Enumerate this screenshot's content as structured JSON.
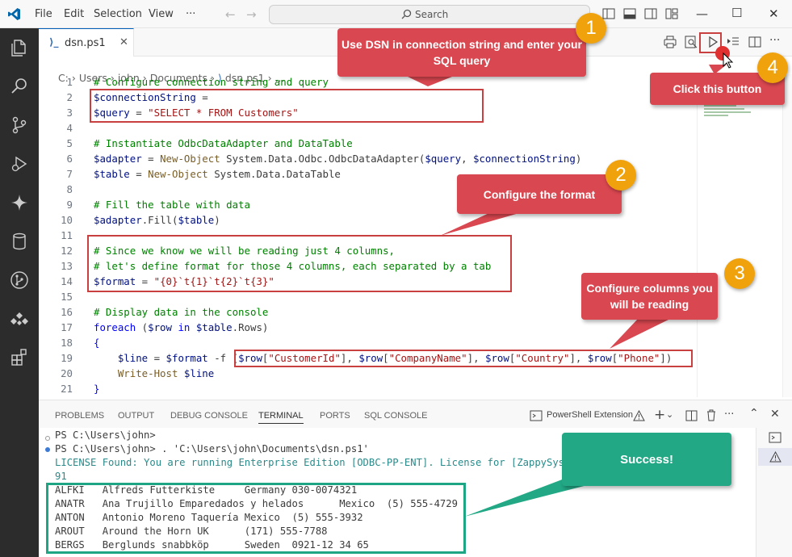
{
  "menu": {
    "file": "File",
    "edit": "Edit",
    "selection": "Selection",
    "view": "View",
    "more": "···"
  },
  "search": {
    "label": "Search"
  },
  "tab": {
    "icon": "⟩_",
    "name": "dsn.ps1",
    "close": "✕"
  },
  "breadcrumb": [
    "C:",
    "Users",
    "john",
    "Documents",
    "dsn.ps1",
    "..."
  ],
  "code_lines": [
    {
      "n": "1",
      "html": "<span class='cm'># Configure connection string and query</span>"
    },
    {
      "n": "2",
      "html": "<span class='vr'>$connectionString</span> ="
    },
    {
      "n": "3",
      "html": "<span class='vr'>$query</span> = <span class='st'>\"SELECT * FROM Customers\"</span>"
    },
    {
      "n": "4",
      "html": ""
    },
    {
      "n": "5",
      "html": "<span class='cm'># Instantiate OdbcDataAdapter and DataTable</span>"
    },
    {
      "n": "6",
      "html": "<span class='vr'>$adapter</span> = <span class='fn'>New-Object</span> System.Data.Odbc.OdbcDataAdapter(<span class='vr'>$query</span>, <span class='vr'>$connectionString</span>)"
    },
    {
      "n": "7",
      "html": "<span class='vr'>$table</span> = <span class='fn'>New-Object</span> System.Data.DataTable"
    },
    {
      "n": "8",
      "html": ""
    },
    {
      "n": "9",
      "html": "<span class='cm'># Fill the table with data</span>"
    },
    {
      "n": "10",
      "html": "<span class='vr'>$adapter</span>.Fill(<span class='vr'>$table</span>)"
    },
    {
      "n": "11",
      "html": ""
    },
    {
      "n": "12",
      "html": "<span class='cm'># Since we know we will be reading just 4 columns,</span>"
    },
    {
      "n": "13",
      "html": "<span class='cm'># let's define format for those 4 columns, each separated by a tab</span>"
    },
    {
      "n": "14",
      "html": "<span class='vr'>$format</span> = <span class='st'>\"{0}`t{1}`t{2}`t{3}\"</span>"
    },
    {
      "n": "15",
      "html": ""
    },
    {
      "n": "16",
      "html": "<span class='cm'># Display data in the console</span>"
    },
    {
      "n": "17",
      "html": "<span class='kw'>foreach</span> (<span class='vr'>$row</span> <span class='kw'>in</span> <span class='vr'>$table</span>.Rows)"
    },
    {
      "n": "18",
      "html": "<span class='kw'>{</span>"
    },
    {
      "n": "19",
      "html": "    <span class='vr'>$line</span> = <span class='vr'>$format</span> -f (<span class='vr'>$row</span>[<span class='st'>\"CustomerId\"</span>], <span class='vr'>$row</span>[<span class='st'>\"CompanyName\"</span>], <span class='vr'>$row</span>[<span class='st'>\"Country\"</span>], <span class='vr'>$row</span>[<span class='st'>\"Phone\"</span>])"
    },
    {
      "n": "20",
      "html": "    <span class='fn'>Write-Host</span> <span class='vr'>$line</span>"
    },
    {
      "n": "21",
      "html": "<span class='kw'>}</span>"
    }
  ],
  "panel_tabs": [
    "PROBLEMS",
    "OUTPUT",
    "DEBUG CONSOLE",
    "TERMINAL",
    "PORTS",
    "SQL CONSOLE"
  ],
  "panel_shell": "PowerShell Extension",
  "terminal_lines": [
    "PS C:\\Users\\john>",
    "PS C:\\Users\\john> . 'C:\\Users\\john\\Documents\\dsn.ps1'",
    "LICENSE Found: You are running Enterprise Edition [ODBC-PP-ENT]. License for [ZappySys].",
    "91",
    "ALFKI   Alfreds Futterkiste     Germany 030-0074321",
    "ANATR   Ana Trujillo Emparedados y helados      Mexico  (5) 555-4729",
    "ANTON   Antonio Moreno Taquería Mexico  (5) 555-3932",
    "AROUT   Around the Horn UK      (171) 555-7788",
    "BERGS   Berglunds snabbköp      Sweden  0921-12 34 65"
  ],
  "callouts": {
    "c1": "Use DSN in connection string and enter your SQL query",
    "c2": "Configure the format",
    "c3": "Configure columns you will be reading",
    "c4": "Click this button",
    "success": "Success!"
  },
  "badges": {
    "b1": "1",
    "b2": "2",
    "b3": "3",
    "b4": "4"
  },
  "colors": {
    "accent": "#005fb8",
    "callout_red": "#d94750",
    "badge_orange": "#f0a20c",
    "success_green": "#22a885"
  }
}
